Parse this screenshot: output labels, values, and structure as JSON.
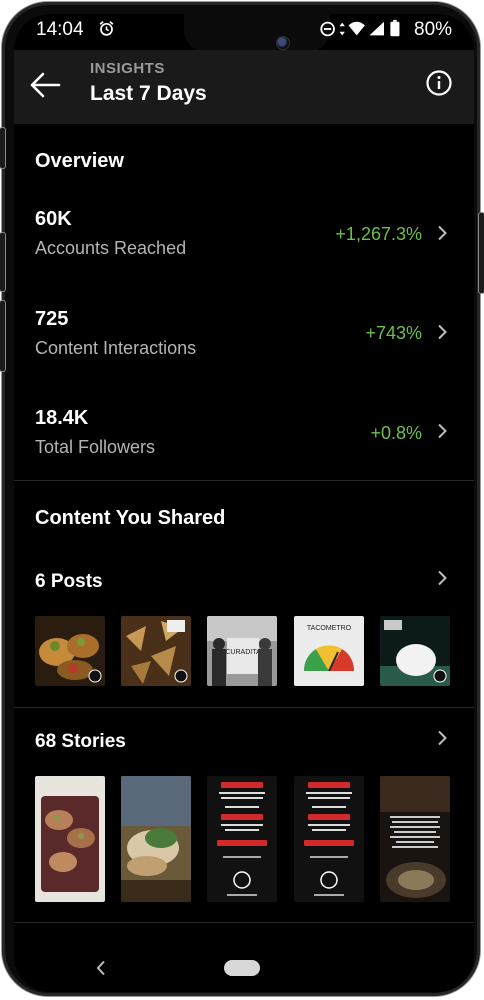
{
  "status_bar": {
    "time": "14:04",
    "battery": "80%",
    "icons": [
      "alarm-clock-icon",
      "minus-circle-icon",
      "data-arrows-icon",
      "wifi-icon",
      "signal-icon",
      "battery-icon"
    ]
  },
  "header": {
    "subtitle": "INSIGHTS",
    "title": "Last 7 Days",
    "back_icon": "arrow-left-icon",
    "info_icon": "info-icon"
  },
  "overview": {
    "title": "Overview",
    "metrics": [
      {
        "value": "60K",
        "label": "Accounts Reached",
        "change": "+1,267.3%"
      },
      {
        "value": "725",
        "label": "Content Interactions",
        "change": "+743%"
      },
      {
        "value": "18.4K",
        "label": "Total Followers",
        "change": "+0.8%"
      }
    ]
  },
  "content": {
    "title": "Content You Shared",
    "posts": {
      "label": "6 Posts",
      "thumbnails": [
        {
          "name": "tacos-platter-post",
          "colors": [
            "#3b2a18",
            "#c58a3a",
            "#6a8a2a"
          ]
        },
        {
          "name": "chips-pile-post",
          "colors": [
            "#5a3a1a",
            "#b58a4a",
            "#7a5226"
          ]
        },
        {
          "name": "people-sign-post",
          "colors": [
            "#8a8a8a",
            "#dcdcdc",
            "#3a3a3a"
          ]
        },
        {
          "name": "taco-meter-post",
          "colors": [
            "#e8e8e8",
            "#3aa04a",
            "#d83a2a"
          ]
        },
        {
          "name": "dough-ball-post",
          "colors": [
            "#0a1a1a",
            "#f0f0f0",
            "#2a6a5a"
          ]
        }
      ]
    },
    "stories": {
      "label": "68 Stories",
      "thumbnails": [
        {
          "name": "tacos-plate-story",
          "colors": [
            "#e8e4de",
            "#5a2a2a",
            "#8a9a4a"
          ]
        },
        {
          "name": "tacos-hand-story",
          "colors": [
            "#6a5a3a",
            "#d8c8a8",
            "#4a7a3a"
          ]
        },
        {
          "name": "menu-announcement-story-1",
          "colors": [
            "#111111",
            "#d02a2a",
            "#ffffff"
          ]
        },
        {
          "name": "menu-announcement-story-2",
          "colors": [
            "#111111",
            "#d02a2a",
            "#ffffff"
          ]
        },
        {
          "name": "tortilla-info-story",
          "colors": [
            "#1a1410",
            "#4a3a2a",
            "#c8b8a0"
          ]
        }
      ]
    }
  },
  "nav": {
    "back_icon": "chevron-left-icon",
    "home_icon": "home-pill-icon"
  },
  "colors": {
    "background": "#000000",
    "header": "#1a1a1a",
    "positive_change": "#6cc04a",
    "muted_text": "#b4b4b4"
  }
}
